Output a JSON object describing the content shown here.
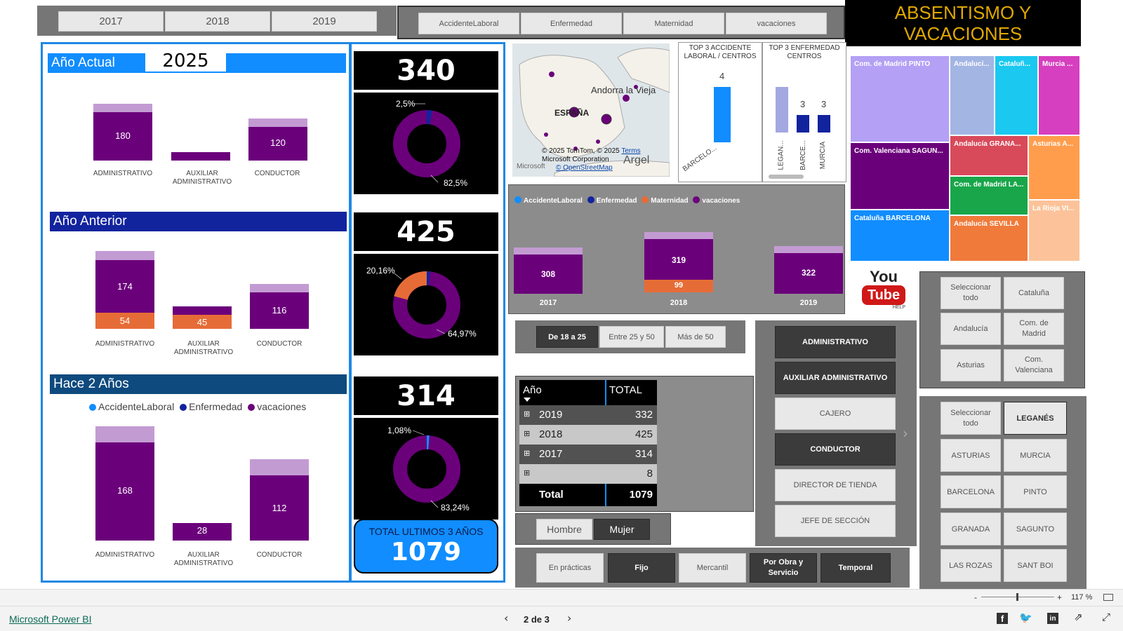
{
  "year_slicer": [
    "2017",
    "2018",
    "2019"
  ],
  "type_slicer": [
    "AccidenteLaboral",
    "Enfermedad",
    "Maternidad",
    "vacaciones"
  ],
  "title": "ABSENTISMO Y VACACIONES",
  "panel": {
    "actual_label": "Año Actual",
    "actual_year": "2025",
    "anterior_label": "Año Anterior",
    "hace2_label": "Hace 2 Años",
    "legend": [
      "AccidenteLaboral",
      "Enfermedad",
      "vacaciones"
    ]
  },
  "colors": {
    "accidente": "#118dff",
    "enfermedad": "#12239e",
    "maternidad": "#e66c37",
    "vacaciones": "#6b007b",
    "cap": "#c39bd3"
  },
  "chart_data": [
    {
      "type": "bar",
      "title": "Año Actual",
      "categories": [
        "ADMINISTRATIVO",
        "AUXILIAR ADMINISTRATIVO",
        "CONDUCTOR"
      ],
      "series": [
        {
          "name": "vacaciones",
          "values": [
            180,
            null,
            120
          ]
        }
      ],
      "labels": [
        "180",
        "",
        "120"
      ]
    },
    {
      "type": "bar",
      "title": "Año Anterior",
      "categories": [
        "ADMINISTRATIVO",
        "AUXILIAR ADMINISTRATIVO",
        "CONDUCTOR"
      ],
      "series": [
        {
          "name": "vacaciones",
          "values": [
            174,
            null,
            116
          ]
        },
        {
          "name": "Maternidad",
          "values": [
            54,
            45,
            null
          ]
        }
      ]
    },
    {
      "type": "bar",
      "title": "Hace 2 Años",
      "categories": [
        "ADMINISTRATIVO",
        "AUXILIAR ADMINISTRATIVO",
        "CONDUCTOR"
      ],
      "series": [
        {
          "name": "vacaciones",
          "values": [
            168,
            28,
            112
          ]
        }
      ]
    },
    {
      "type": "pie",
      "values": [
        82.5,
        2.5
      ],
      "labels": [
        "82,5%",
        "2,5%"
      ]
    },
    {
      "type": "pie",
      "values": [
        64.97,
        20.16
      ],
      "labels": [
        "64,97%",
        "20,16%"
      ]
    },
    {
      "type": "pie",
      "values": [
        83.24,
        1.08
      ],
      "labels": [
        "83,24%",
        "1,08%"
      ]
    },
    {
      "type": "bar",
      "title": "TOP 3 ACCIDENTE LABORAL / CENTROS",
      "categories": [
        "BARCELO..."
      ],
      "values": [
        4
      ]
    },
    {
      "type": "bar",
      "title": "TOP 3 ENFERMEDAD CENTROS",
      "categories": [
        "LEGAN...",
        "BARCE...",
        "MURCIA"
      ],
      "values": [
        null,
        3,
        3
      ]
    },
    {
      "type": "bar",
      "legend": [
        "AccidenteLaboral",
        "Enfermedad",
        "Maternidad",
        "vacaciones"
      ],
      "categories": [
        "2017",
        "2018",
        "2019"
      ],
      "series": [
        {
          "name": "vacaciones",
          "values": [
            308,
            319,
            322
          ]
        },
        {
          "name": "Maternidad",
          "values": [
            null,
            99,
            null
          ]
        }
      ]
    }
  ],
  "kpis": [
    "340",
    "425",
    "314"
  ],
  "total_label": "TOTAL ULTIMOS 3 AÑOS",
  "total_value": "1079",
  "map": {
    "place1": "Andorra la Vieja",
    "place2": "ESPAÑA",
    "place3": "Argel",
    "copyright": "© 2025 TomTom, © 2025",
    "terms": "Terms",
    "corp": "Microsoft Corporation",
    "osm": "© OpenStreetMap",
    "ms": "Microsoft"
  },
  "treemap": [
    "Com. de Madrid PINTO",
    "Andalucí...",
    "Cataluñ...",
    "Murcia ...",
    "Com. Valenciana SAGUN...",
    "Andalucía GRANA...",
    "Asturias A...",
    "Com. de Madrid LA...",
    "Cataluña BARCELONA",
    "Andalucía SEVILLA",
    "La Rioja VI..."
  ],
  "age_slicer": [
    "De 18 a 25",
    "Entre 25 y 50",
    "Más de 50"
  ],
  "table": {
    "headers": [
      "Año",
      "TOTAL"
    ],
    "rows": [
      [
        "2019",
        "332"
      ],
      [
        "2018",
        "425"
      ],
      [
        "2017",
        "314"
      ],
      [
        "",
        "8"
      ]
    ],
    "total": [
      "Total",
      "1079"
    ]
  },
  "gender_slicer": [
    "Hombre",
    "Mujer"
  ],
  "contract_slicer": [
    "En prácticas",
    "Fijo",
    "Mercantil",
    "Por Obra y Servicio",
    "Temporal"
  ],
  "job_slicer": [
    "ADMINISTRATIVO",
    "AUXILIAR ADMINISTRATIVO",
    "CAJERO",
    "CONDUCTOR",
    "DIRECTOR DE TIENDA",
    "JEFE DE SECCIÓN"
  ],
  "region_slicer": [
    "Seleccionar todo",
    "Cataluña",
    "Andalucía",
    "Com. de Madrid",
    "Asturias",
    "Com. Valenciana"
  ],
  "city_slicer": [
    "Seleccionar todo",
    "LEGANÉS",
    "ASTURIAS",
    "MURCIA",
    "BARCELONA",
    "PINTO",
    "GRANADA",
    "SAGUNTO",
    "LAS ROZAS",
    "SANT BOI"
  ],
  "youtube": {
    "you": "You",
    "tube": "Tube",
    "help": "HELP"
  },
  "zoom": {
    "minus": "-",
    "plus": "+",
    "value": "117 %"
  },
  "footer": {
    "brand": "Microsoft Power BI",
    "page": "2 de 3"
  }
}
